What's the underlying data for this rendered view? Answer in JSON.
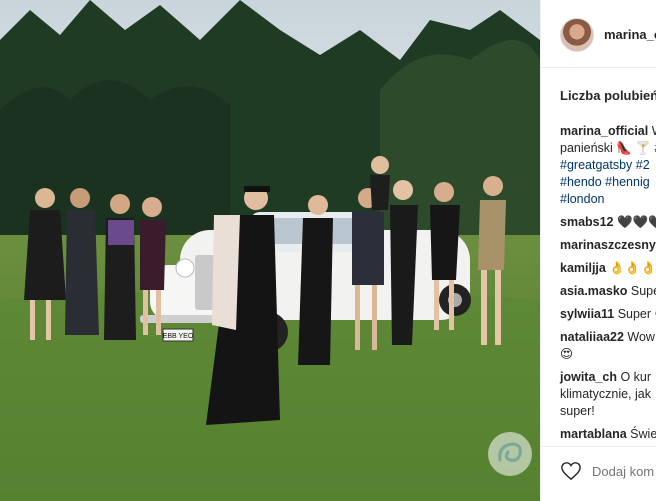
{
  "header": {
    "username": "marina_o"
  },
  "likes_label": "Liczba polubień",
  "comments": [
    {
      "user": "marina_official",
      "text": " W",
      "lines": [
        "panieński 👠 🍸 #",
        "#greatgatsby #2",
        "#hendo #hennig",
        "#london"
      ]
    },
    {
      "user": "smabs12",
      "text": " 🖤🖤🖤"
    },
    {
      "user": "marinaszczesny",
      "text": ""
    },
    {
      "user": "kamiljja",
      "text": " 👌👌👌"
    },
    {
      "user": "asia.masko",
      "text": " Supe"
    },
    {
      "user": "sylwiia11",
      "text": " Super 😊"
    },
    {
      "user": "nataliiaa22",
      "text": " Wow",
      "lines": [
        "😍"
      ]
    },
    {
      "user": "jowita_ch",
      "text": " O kur",
      "lines": [
        "klimatycznie, jak",
        "super!"
      ]
    },
    {
      "user": "martablana",
      "text": " Świe"
    }
  ],
  "comment_input": {
    "placeholder": "Dodaj kom"
  },
  "icons": {
    "like": "heart-icon",
    "watermark": "site-logo-watermark"
  },
  "photo": {
    "plate": "EBB YEO"
  },
  "colors": {
    "hashtag": "#003569",
    "text": "#262626",
    "grass": "#5f8a3a",
    "trees": "#1f3a22"
  }
}
